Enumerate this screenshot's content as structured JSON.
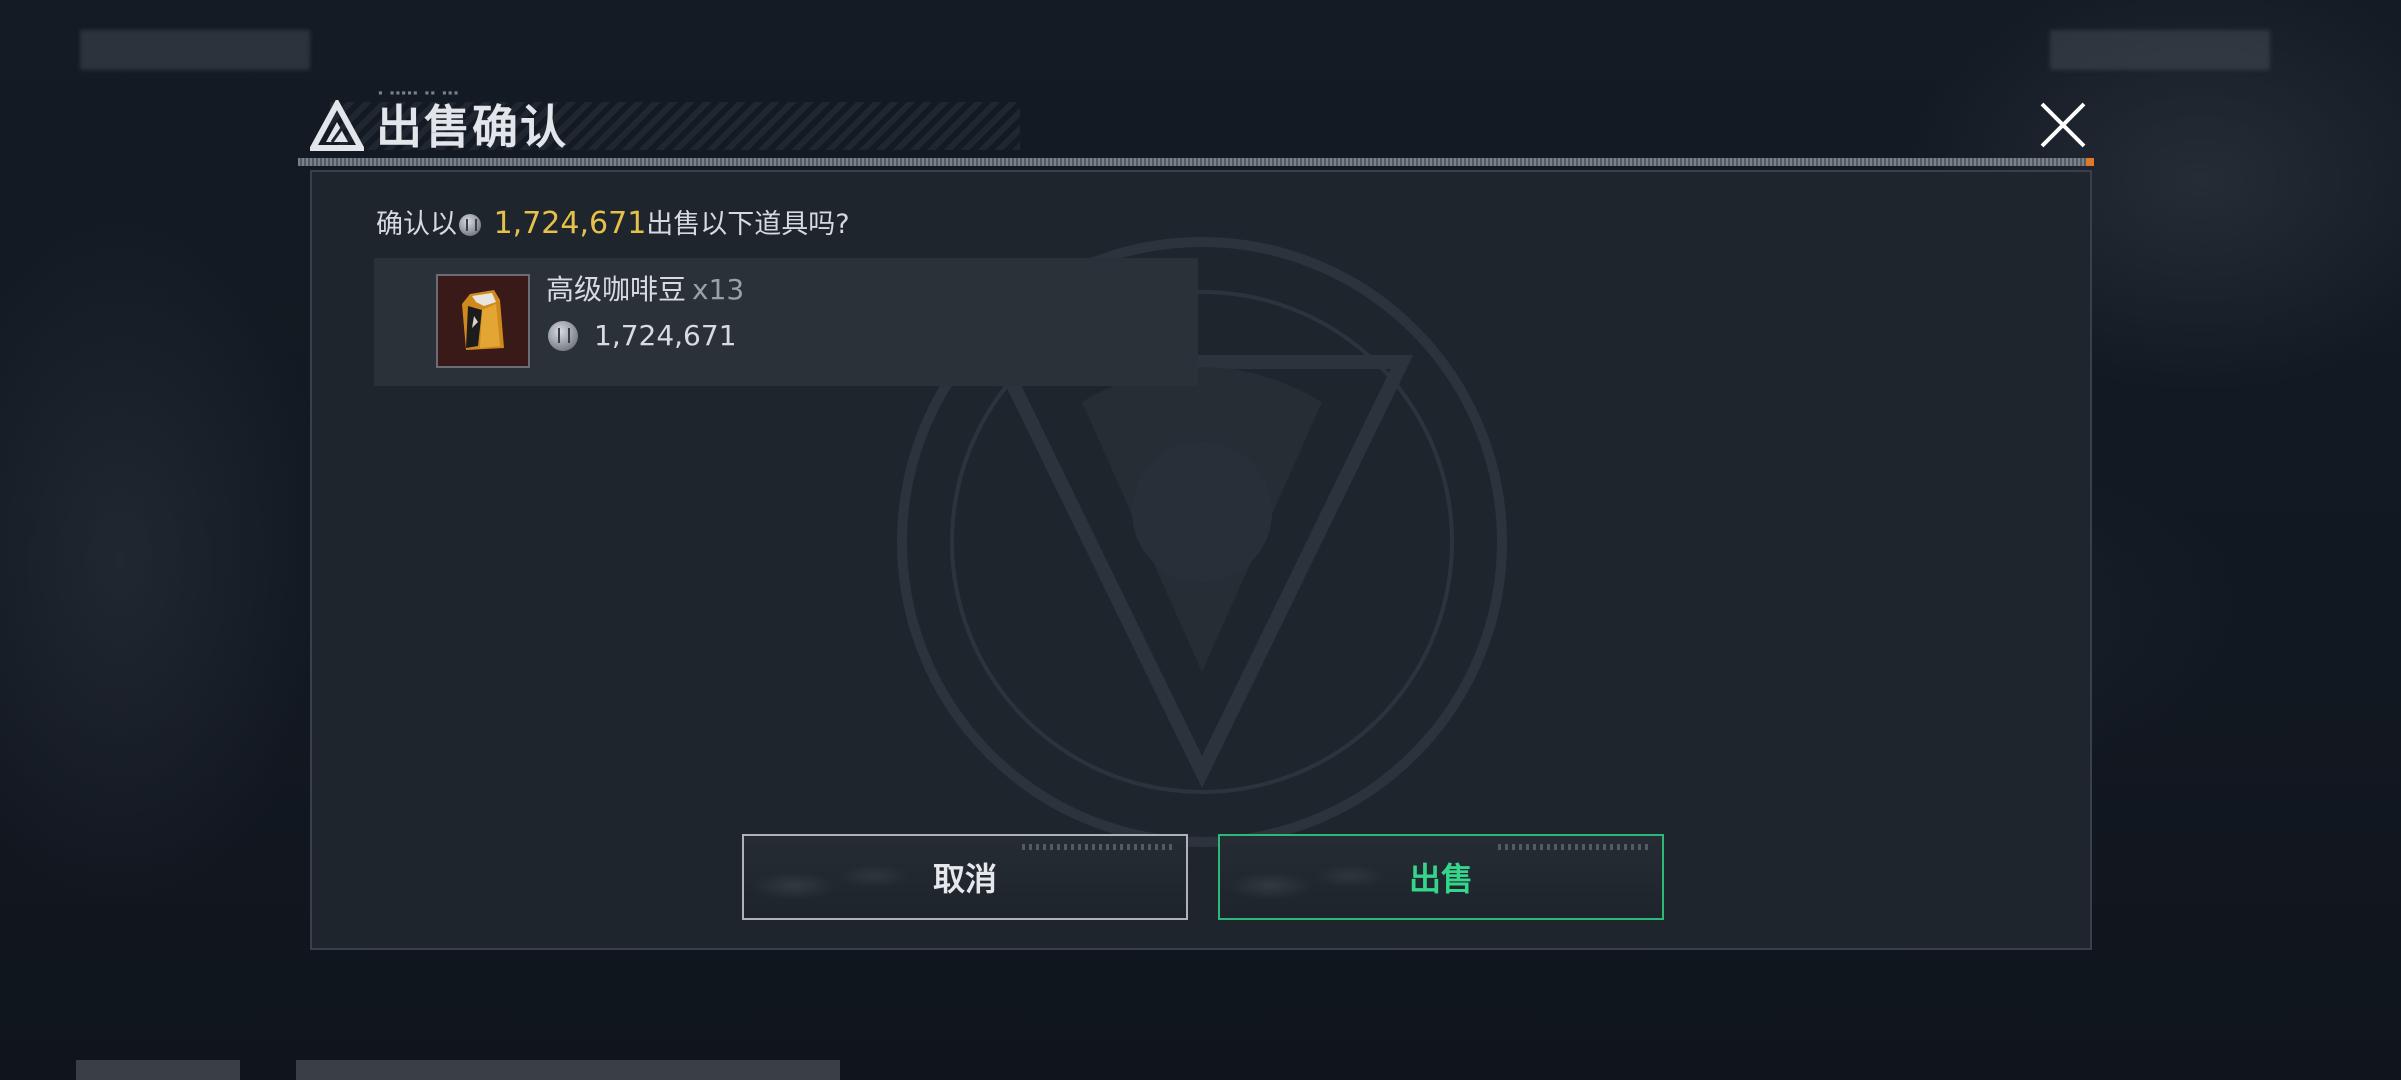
{
  "dialog": {
    "title": "出售确认",
    "close_icon": "close-icon"
  },
  "confirm": {
    "prefix": "确认以",
    "amount": "1,724,671",
    "suffix": "出售以下道具吗?"
  },
  "item": {
    "name": "高级咖啡豆",
    "quantity": "x13",
    "price": "1,724,671",
    "thumbnail_icon": "coffee-bean-bag-icon"
  },
  "buttons": {
    "cancel_label": "取消",
    "sell_label": "出售"
  },
  "colors": {
    "amount": "#e6c14a",
    "sell_accent": "#33d68a",
    "panel": "#1f252d",
    "item_background": "#2b3139"
  }
}
